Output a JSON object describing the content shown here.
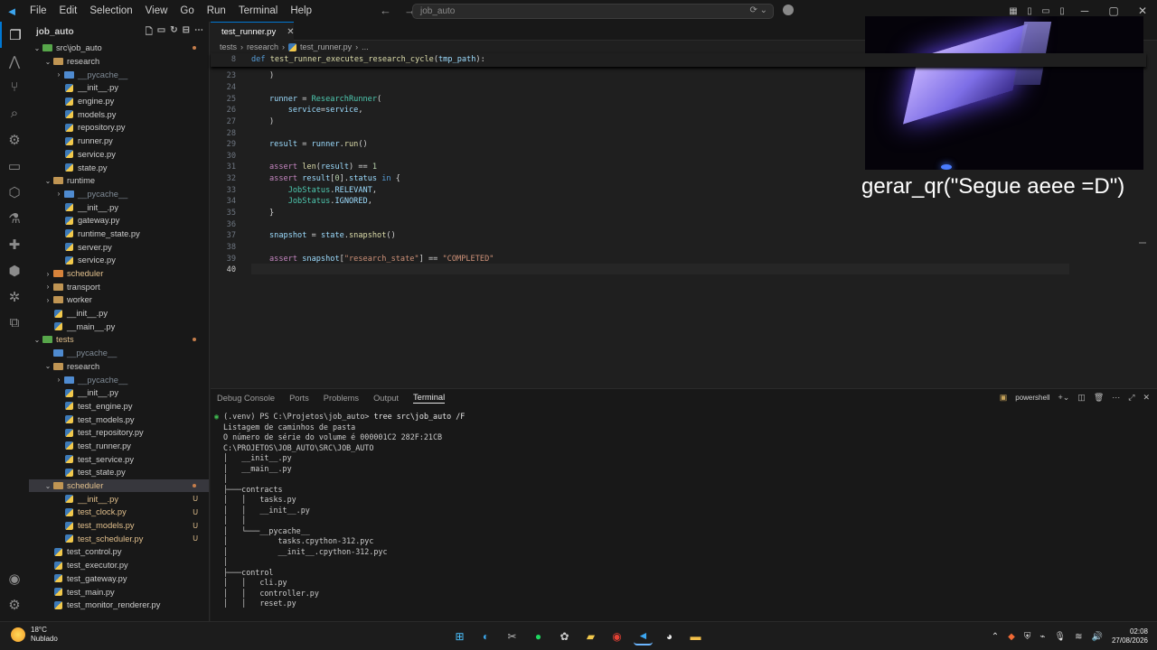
{
  "menu": [
    "File",
    "Edit",
    "Selection",
    "View",
    "Go",
    "Run",
    "Terminal",
    "Help"
  ],
  "search": {
    "text": "job_auto"
  },
  "sidebar": {
    "title": "job_auto",
    "items": [
      {
        "label": "src\\job_auto",
        "kind": "folder",
        "depth": 0,
        "open": true,
        "color": "green",
        "dot": true
      },
      {
        "label": "research",
        "kind": "folder",
        "depth": 1,
        "open": true
      },
      {
        "label": "__pycache__",
        "kind": "folder",
        "depth": 2,
        "open": false,
        "color": "blue",
        "dim": true
      },
      {
        "label": "__init__.py",
        "kind": "py",
        "depth": 2
      },
      {
        "label": "engine.py",
        "kind": "py",
        "depth": 2
      },
      {
        "label": "models.py",
        "kind": "py",
        "depth": 2
      },
      {
        "label": "repository.py",
        "kind": "py",
        "depth": 2
      },
      {
        "label": "runner.py",
        "kind": "py",
        "depth": 2
      },
      {
        "label": "service.py",
        "kind": "py",
        "depth": 2
      },
      {
        "label": "state.py",
        "kind": "py",
        "depth": 2
      },
      {
        "label": "runtime",
        "kind": "folder",
        "depth": 1,
        "open": true
      },
      {
        "label": "__pycache__",
        "kind": "folder",
        "depth": 2,
        "open": false,
        "color": "blue",
        "dim": true
      },
      {
        "label": "__init__.py",
        "kind": "py",
        "depth": 2
      },
      {
        "label": "gateway.py",
        "kind": "py",
        "depth": 2
      },
      {
        "label": "runtime_state.py",
        "kind": "py",
        "depth": 2
      },
      {
        "label": "server.py",
        "kind": "py",
        "depth": 2
      },
      {
        "label": "service.py",
        "kind": "py",
        "depth": 2
      },
      {
        "label": "scheduler",
        "kind": "folder",
        "depth": 1,
        "open": false,
        "mod": true,
        "color": "orange"
      },
      {
        "label": "transport",
        "kind": "folder",
        "depth": 1,
        "open": false
      },
      {
        "label": "worker",
        "kind": "folder",
        "depth": 1,
        "open": false
      },
      {
        "label": "__init__.py",
        "kind": "py",
        "depth": 1
      },
      {
        "label": "__main__.py",
        "kind": "py",
        "depth": 1
      },
      {
        "label": "tests",
        "kind": "folder",
        "depth": 0,
        "open": true,
        "color": "green",
        "mod": true,
        "dot": true
      },
      {
        "label": "__pycache__",
        "kind": "folder",
        "depth": 1,
        "open": false,
        "color": "blue",
        "dim": true,
        "nochev": true
      },
      {
        "label": "research",
        "kind": "folder",
        "depth": 1,
        "open": true
      },
      {
        "label": "__pycache__",
        "kind": "folder",
        "depth": 2,
        "open": false,
        "color": "blue",
        "dim": true
      },
      {
        "label": "__init__.py",
        "kind": "py",
        "depth": 2
      },
      {
        "label": "test_engine.py",
        "kind": "py",
        "depth": 2
      },
      {
        "label": "test_models.py",
        "kind": "py",
        "depth": 2
      },
      {
        "label": "test_repository.py",
        "kind": "py",
        "depth": 2
      },
      {
        "label": "test_runner.py",
        "kind": "py",
        "depth": 2
      },
      {
        "label": "test_service.py",
        "kind": "py",
        "depth": 2
      },
      {
        "label": "test_state.py",
        "kind": "py",
        "depth": 2
      },
      {
        "label": "scheduler",
        "kind": "folder",
        "depth": 1,
        "open": true,
        "mod": true,
        "selected": true,
        "dot": true
      },
      {
        "label": "__init__.py",
        "kind": "py",
        "depth": 2,
        "mod": true,
        "badge": "U"
      },
      {
        "label": "test_clock.py",
        "kind": "py",
        "depth": 2,
        "mod": true,
        "badge": "U"
      },
      {
        "label": "test_models.py",
        "kind": "py",
        "depth": 2,
        "mod": true,
        "badge": "U"
      },
      {
        "label": "test_scheduler.py",
        "kind": "py",
        "depth": 2,
        "mod": true,
        "badge": "U"
      },
      {
        "label": "test_control.py",
        "kind": "py",
        "depth": 1
      },
      {
        "label": "test_executor.py",
        "kind": "py",
        "depth": 1
      },
      {
        "label": "test_gateway.py",
        "kind": "py",
        "depth": 1
      },
      {
        "label": "test_main.py",
        "kind": "py",
        "depth": 1
      },
      {
        "label": "test_monitor_renderer.py",
        "kind": "py",
        "depth": 1
      }
    ]
  },
  "editor": {
    "tab": "test_runner.py",
    "breadcrumb": [
      "tests",
      "research",
      "test_runner.py",
      "..."
    ],
    "sticky_ln": "8",
    "lines": [
      {
        "n": "23",
        "t": 1,
        "parts": [
          [
            "pl",
            ")"
          ]
        ]
      },
      {
        "n": "24",
        "t": 2,
        "parts": []
      },
      {
        "n": "25",
        "t": 3,
        "parts": [
          [
            "var",
            "runner"
          ],
          [
            "pl",
            " = "
          ],
          [
            "cls",
            "ResearchRunner"
          ],
          [
            "pl",
            "("
          ]
        ]
      },
      {
        "n": "26",
        "t": 4,
        "parts": [
          [
            "pl",
            "    "
          ],
          [
            "var",
            "service"
          ],
          [
            "pl",
            "="
          ],
          [
            "var",
            "service"
          ],
          [
            "pl",
            ","
          ]
        ]
      },
      {
        "n": "27",
        "t": 5,
        "parts": [
          [
            "pl",
            ")"
          ]
        ]
      },
      {
        "n": "28",
        "t": 6,
        "parts": []
      },
      {
        "n": "29",
        "t": 7,
        "parts": [
          [
            "var",
            "result"
          ],
          [
            "pl",
            " = "
          ],
          [
            "var",
            "runner"
          ],
          [
            "pl",
            "."
          ],
          [
            "fn",
            "run"
          ],
          [
            "pl",
            "()"
          ]
        ]
      },
      {
        "n": "30",
        "t": 8,
        "parts": []
      },
      {
        "n": "31",
        "t": 9,
        "parts": [
          [
            "ctl",
            "assert"
          ],
          [
            "pl",
            " "
          ],
          [
            "fn",
            "len"
          ],
          [
            "pl",
            "("
          ],
          [
            "var",
            "result"
          ],
          [
            "pl",
            ") == "
          ],
          [
            "num",
            "1"
          ]
        ]
      },
      {
        "n": "32",
        "t": 10,
        "parts": [
          [
            "ctl",
            "assert"
          ],
          [
            "pl",
            " "
          ],
          [
            "var",
            "result"
          ],
          [
            "pl",
            "["
          ],
          [
            "num",
            "0"
          ],
          [
            "pl",
            "]."
          ],
          [
            "var",
            "status"
          ],
          [
            "pl",
            " "
          ],
          [
            "kw",
            "in"
          ],
          [
            "pl",
            " {"
          ]
        ]
      },
      {
        "n": "33",
        "t": 11,
        "parts": [
          [
            "pl",
            "    "
          ],
          [
            "cls",
            "JobStatus"
          ],
          [
            "pl",
            "."
          ],
          [
            "var",
            "RELEVANT"
          ],
          [
            "pl",
            ","
          ]
        ]
      },
      {
        "n": "34",
        "t": 12,
        "parts": [
          [
            "pl",
            "    "
          ],
          [
            "cls",
            "JobStatus"
          ],
          [
            "pl",
            "."
          ],
          [
            "var",
            "IGNORED"
          ],
          [
            "pl",
            ","
          ]
        ]
      },
      {
        "n": "35",
        "t": 13,
        "parts": [
          [
            "pl",
            "}"
          ]
        ]
      },
      {
        "n": "36",
        "t": 14,
        "parts": []
      },
      {
        "n": "37",
        "t": 15,
        "parts": [
          [
            "var",
            "snapshot"
          ],
          [
            "pl",
            " = "
          ],
          [
            "var",
            "state"
          ],
          [
            "pl",
            "."
          ],
          [
            "fn",
            "snapshot"
          ],
          [
            "pl",
            "()"
          ]
        ]
      },
      {
        "n": "38",
        "t": 16,
        "parts": []
      },
      {
        "n": "39",
        "t": 17,
        "parts": [
          [
            "ctl",
            "assert"
          ],
          [
            "pl",
            " "
          ],
          [
            "var",
            "snapshot"
          ],
          [
            "pl",
            "["
          ],
          [
            "str",
            "\"research_state\""
          ],
          [
            "pl",
            "] == "
          ],
          [
            "str",
            "\"COMPLETED\""
          ]
        ]
      },
      {
        "n": "40",
        "t": 18,
        "parts": [],
        "current": true
      }
    ]
  },
  "panel": {
    "tabs": [
      "Debug Console",
      "Ports",
      "Problems",
      "Output",
      "Terminal"
    ],
    "active_tab": "Terminal",
    "shell": "powershell",
    "prompt_env": "(.venv)",
    "prompt_path": " PS C:\\Projetos\\job_auto> ",
    "command": "tree src\\job_auto /F",
    "output": [
      "Listagem de caminhos de pasta",
      "O número de série do volume é 000001C2 282F:21CB",
      "C:\\PROJETOS\\JOB_AUTO\\SRC\\JOB_AUTO",
      "│   __init__.py",
      "│   __main__.py",
      "│",
      "├───contracts",
      "│   │   tasks.py",
      "│   │   __init__.py",
      "│   │",
      "│   └───__pycache__",
      "│           tasks.cpython-312.pyc",
      "│           __init__.cpython-312.pyc",
      "│",
      "├───control",
      "│   │   cli.py",
      "│   │   controller.py",
      "│   │   reset.py"
    ]
  },
  "overlay": {
    "caption": "gerar_qr(\"Segue aeee =D\")"
  },
  "taskbar": {
    "weather_temp": "18°C",
    "weather_desc": "Nublado",
    "time": "02:08",
    "date": "27/08/2026"
  },
  "colors": {
    "accent": "#0078d4",
    "modified": "#e2c08d"
  }
}
